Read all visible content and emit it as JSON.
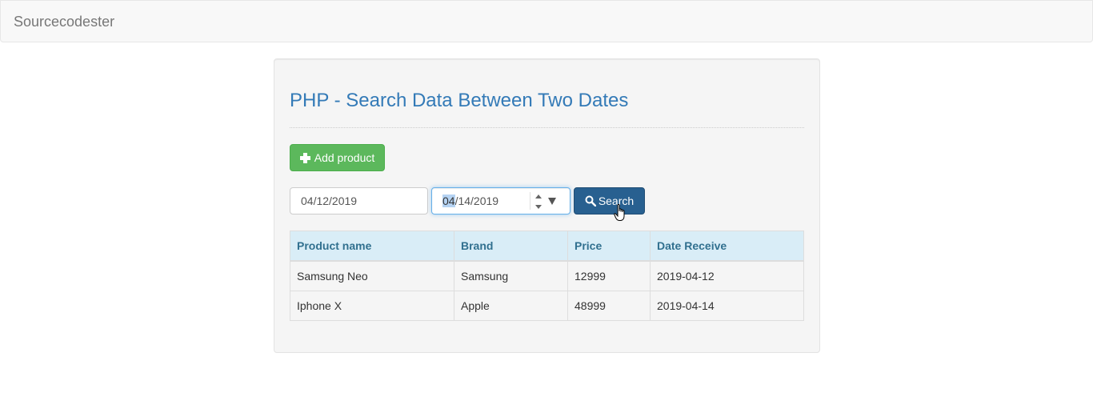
{
  "navbar": {
    "brand": "Sourcecodester"
  },
  "page": {
    "title": "PHP - Search Data Between Two Dates",
    "add_button_label": "Add product",
    "search_button_label": "Search"
  },
  "search_form": {
    "start_date": "04/12/2019",
    "end_date_selected_segment": "04",
    "end_date_rest": "/14/2019"
  },
  "table": {
    "headers": [
      "Product name",
      "Brand",
      "Price",
      "Date Receive"
    ],
    "rows": [
      [
        "Samsung Neo",
        "Samsung",
        "12999",
        "2019-04-12"
      ],
      [
        "Iphone X",
        "Apple",
        "48999",
        "2019-04-14"
      ]
    ]
  },
  "colors": {
    "title": "#337ab7",
    "add_button": "#5cb85c",
    "search_button": "#286090",
    "table_header_bg": "#d9edf7",
    "table_header_text": "#31708f"
  },
  "icons": {
    "add_button": "plus-icon",
    "search_button": "search-icon",
    "cursor": "hand-pointer-cursor-icon"
  }
}
